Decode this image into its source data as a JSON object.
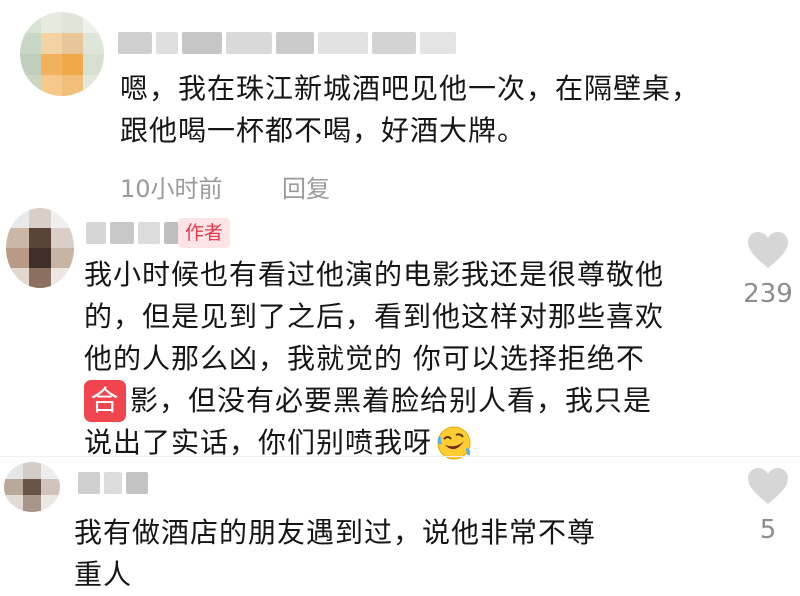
{
  "comments": [
    {
      "text_lines": [
        "嗯，我在珠江新城酒吧见他一次，在隔壁桌，",
        "跟他喝一杯都不喝，好酒大牌。"
      ],
      "time": "10小时前",
      "reply_label": "回复"
    },
    {
      "author_tag": "作者",
      "text_lines": [
        "我小时候也有看过他演的电影我还是很尊敬他",
        "的，但是见到了之后，看到他这样对那些喜欢",
        "他的人那么凶，我就觉的 你可以选择拒绝不"
      ],
      "badge_char": "合",
      "line4_rest": "影，但没有必要黑着脸给别人看，我只是",
      "line5": "说出了实话，你们别喷我呀",
      "like_count": "239",
      "emoji_icon": "rolling-on-floor-laughing-emoji"
    },
    {
      "text_lines": [
        "我有做酒店的朋友遇到过，说他非常不尊",
        "重人"
      ],
      "like_count": "5"
    }
  ],
  "colors": {
    "author_tag_bg": "#fde5e7",
    "author_tag_fg": "#e8394a",
    "meta_gray": "#9a9a9a",
    "like_gray": "#8d8d8d"
  }
}
